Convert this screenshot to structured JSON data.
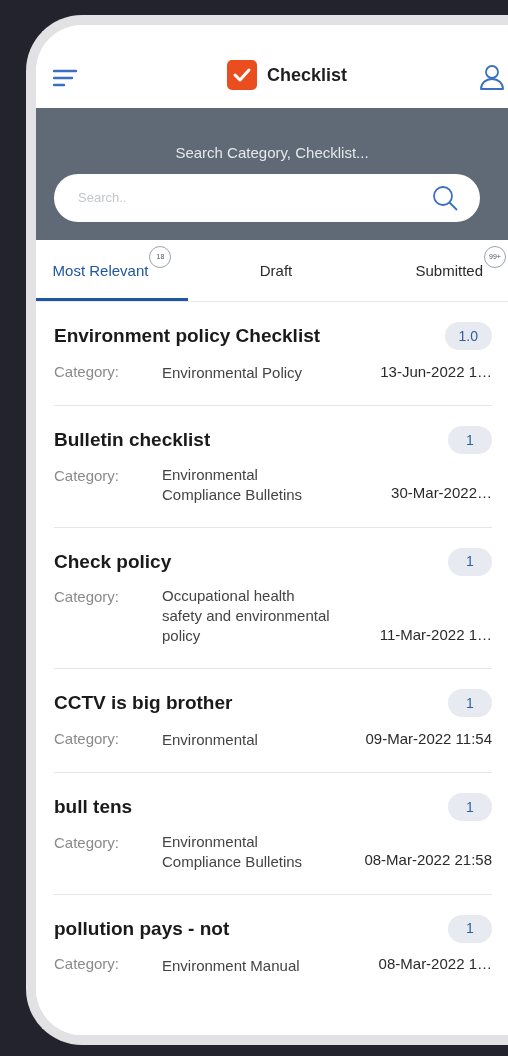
{
  "header": {
    "title": "Checklist"
  },
  "search": {
    "caption": "Search Category, Checklist...",
    "placeholder": "Search.."
  },
  "tabs": [
    {
      "label": "Most Relevant",
      "badge": "18",
      "selected": true
    },
    {
      "label": "Draft",
      "selected": false
    },
    {
      "label": "Submitted",
      "badge": "99+",
      "selected": false
    }
  ],
  "checklists": [
    {
      "title": "Environment policy Checklist",
      "version": "1.0",
      "category_label": "Category:",
      "category": "Environmental Policy",
      "date": "13-Jun-2022 1…"
    },
    {
      "title": "Bulletin checklist",
      "version": "1",
      "category_label": "Category:",
      "category": "Environmental Compliance Bulletins",
      "date": "30-Mar-2022…"
    },
    {
      "title": "Check policy",
      "version": "1",
      "category_label": "Category:",
      "category": "Occupational health safety and environmental policy",
      "date": "11-Mar-2022 1…"
    },
    {
      "title": "CCTV is big brother",
      "version": "1",
      "category_label": "Category:",
      "category": "Environmental",
      "date": "09-Mar-2022 11:54"
    },
    {
      "title": "bull tens",
      "version": "1",
      "category_label": "Category:",
      "category": "Environmental Compliance Bulletins",
      "date": "08-Mar-2022 21:58"
    },
    {
      "title": "pollution pays - not",
      "version": "1",
      "category_label": "Category:",
      "category": "Environment Manual",
      "date": "08-Mar-2022 1…"
    }
  ]
}
